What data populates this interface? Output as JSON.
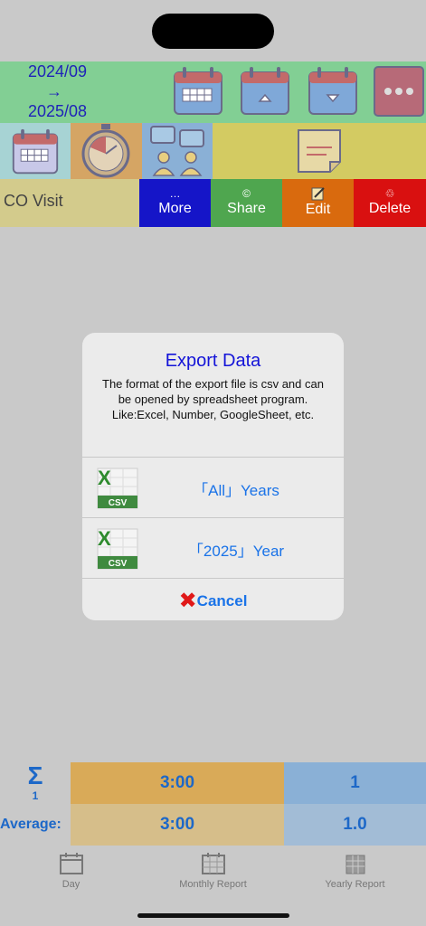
{
  "header": {
    "range_start": "2024/09",
    "range_arrow": "→",
    "range_end": "2025/08"
  },
  "toolbar": {
    "icons": [
      "calendar-icon",
      "calendar-prev-icon",
      "calendar-next-icon",
      "more-dots-icon"
    ],
    "row2_icons": [
      "calendar-grid-icon",
      "timer-icon",
      "people-chat-icon",
      "note-icon"
    ]
  },
  "entry": {
    "title": "CO Visit",
    "more_icon": "…",
    "more_label": "More",
    "share_icon": "©",
    "share_label": "Share",
    "edit_label": "Edit",
    "delete_icon": "♲",
    "delete_label": "Delete"
  },
  "dialog": {
    "title": "Export Data",
    "message": "The format of the export file is csv and can be opened by spreadsheet program. Like:Excel, Number, GoogleSheet, etc.",
    "csv_badge": "CSV",
    "option_all": "「All」Years",
    "option_year": "「2025」Year",
    "cancel_label": "Cancel",
    "cancel_icon": "✖"
  },
  "summary": {
    "sigma": "Σ",
    "count_label": "1",
    "total_hours": "3:00",
    "total_count": "1",
    "average_label": "Average:",
    "avg_hours": "3:00",
    "avg_count": "1.0"
  },
  "tabs": {
    "day": "Day",
    "monthly": "Monthly Report",
    "yearly": "Yearly Report"
  },
  "colors": {
    "header_green": "#82cf94",
    "more_blue": "#1515c8",
    "share_green": "#4fa64f",
    "edit_orange": "#d96a0e",
    "delete_red": "#d91010"
  }
}
